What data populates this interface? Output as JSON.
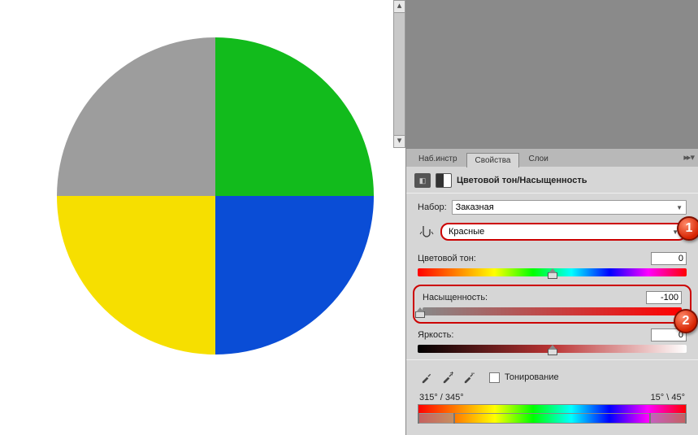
{
  "tabs": {
    "presets": "Наб.инстр",
    "properties": "Свойства",
    "layers": "Слои"
  },
  "panel_title": "Цветовой тон/Насыщенность",
  "preset": {
    "label": "Набор:",
    "value": "Заказная"
  },
  "channel": {
    "value": "Красные"
  },
  "hue": {
    "label": "Цветовой тон:",
    "value": "0"
  },
  "saturation": {
    "label": "Насыщенность:",
    "value": "-100"
  },
  "lightness": {
    "label": "Яркость:",
    "value": "0"
  },
  "colorize": {
    "label": "Тонирование"
  },
  "range": {
    "left": "315° / 345°",
    "right": "15° \\ 45°"
  },
  "badges": {
    "one": "1",
    "two": "2"
  }
}
